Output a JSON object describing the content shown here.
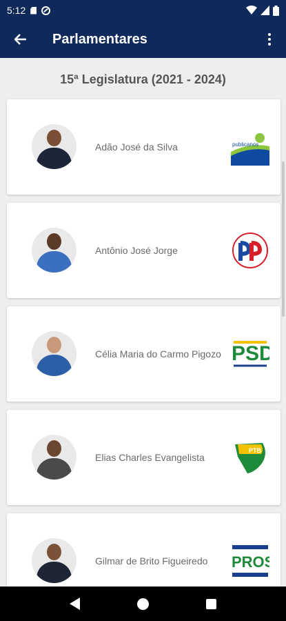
{
  "status_bar": {
    "time": "5:12"
  },
  "app_bar": {
    "title": "Parlamentares"
  },
  "legislature": "15ª Legislatura (2021 - 2024)",
  "parliamentarians": [
    {
      "name": "Adão José da Silva",
      "party_icon": "republicanos-logo",
      "skin": "#7a4f35",
      "clothing": "#1c2438"
    },
    {
      "name": "Antônio José Jorge",
      "party_icon": "partido-progressista-logo",
      "skin": "#5b3a28",
      "clothing": "#3b70c0"
    },
    {
      "name": "Célia Maria do Carmo Pigozo",
      "party_icon": "psd-logo",
      "skin": "#c89a7a",
      "clothing": "#2c5fa8"
    },
    {
      "name": "Elias Charles Evangelista",
      "party_icon": "ptb-logo",
      "skin": "#6b4631",
      "clothing": "#4a4a4a"
    },
    {
      "name": "Gilmar de Brito Figueiredo",
      "party_icon": "pros-logo",
      "skin": "#7b5238",
      "clothing": "#1e2535"
    }
  ],
  "colors": {
    "app_bar": "#0f2a5a",
    "background": "#eeeeee",
    "card": "#ffffff"
  }
}
